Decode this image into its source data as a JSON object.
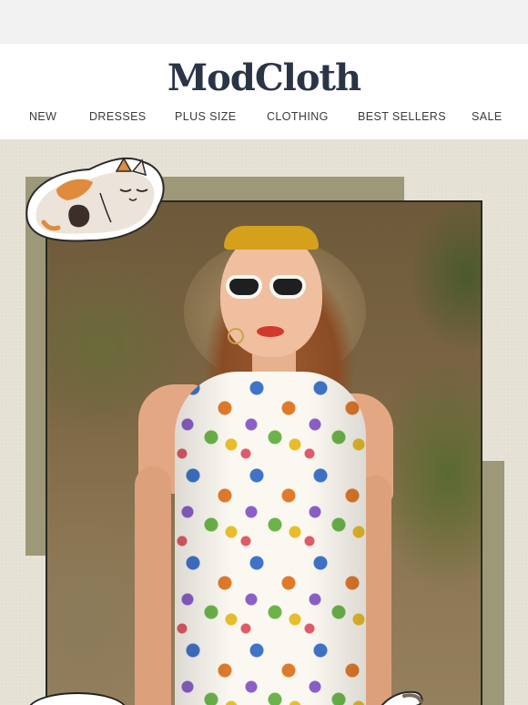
{
  "brand": {
    "logo_text": "ModCloth"
  },
  "nav": {
    "items": [
      {
        "label": "NEW"
      },
      {
        "label": "DRESSES"
      },
      {
        "label": "PLUS SIZE"
      },
      {
        "label": "CLOTHING"
      },
      {
        "label": "BEST SELLERS"
      },
      {
        "label": "SALE"
      }
    ]
  },
  "hero": {
    "image_subject": "model-in-cat-print-dress",
    "frame_color": "#9c9878",
    "background_color": "#e6e2d6"
  },
  "colors": {
    "logo": "#2b3447",
    "nav_text": "#3a3a3a",
    "header_bg": "#ffffff",
    "top_strip": "#f2f2f2"
  },
  "icons": {
    "top_left_sticker": "sleeping-cat-icon"
  }
}
